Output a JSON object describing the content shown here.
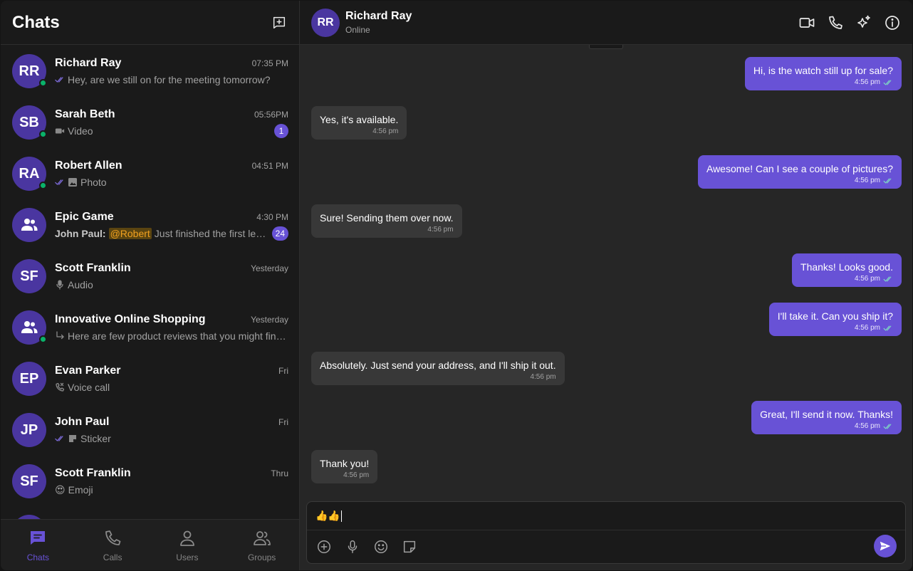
{
  "sidebar": {
    "title": "Chats",
    "chats": [
      {
        "initials": "RR",
        "name": "Richard Ray",
        "time": "07:35 PM",
        "preview": "Hey, are we still on for the meeting tomorrow?",
        "online": true,
        "read": true
      },
      {
        "initials": "SB",
        "name": "Sarah Beth",
        "time": "05:56PM",
        "preview": "Video",
        "online": true,
        "badge": "1"
      },
      {
        "initials": "RA",
        "name": "Robert Allen",
        "time": "04:51 PM",
        "preview": "Photo",
        "online": true,
        "read": true
      },
      {
        "name": "Epic Game",
        "time": "4:30 PM",
        "sender": "John Paul:",
        "mention": "@Robert",
        "preview": "Just finished the first level",
        "badge": "24",
        "group": true
      },
      {
        "initials": "SF",
        "name": "Scott Franklin",
        "time": "Yesterday",
        "preview": "Audio"
      },
      {
        "name": "Innovative Online Shopping",
        "time": "Yesterday",
        "preview": "Here are few product reviews that you might find useful",
        "online": true,
        "group": true
      },
      {
        "initials": "EP",
        "name": "Evan Parker",
        "time": "Fri",
        "preview": "Voice call"
      },
      {
        "initials": "JP",
        "name": "John Paul",
        "time": "Fri",
        "preview": "Sticker",
        "read": true
      },
      {
        "initials": "SF",
        "name": "Scott Franklin",
        "time": "Thru",
        "preview": "Emoji",
        "emoji": "😍"
      }
    ]
  },
  "nav": {
    "chats": "Chats",
    "calls": "Calls",
    "users": "Users",
    "groups": "Groups"
  },
  "conversation": {
    "initials": "RR",
    "name": "Richard Ray",
    "status": "Online",
    "messages": [
      {
        "dir": "out",
        "text": "Hi, is the watch still up for sale?",
        "time": "4:56 pm"
      },
      {
        "dir": "in",
        "text": "Yes, it's available.",
        "time": "4:56 pm"
      },
      {
        "dir": "out",
        "text": "Awesome! Can I see a couple of pictures?",
        "time": "4:56 pm"
      },
      {
        "dir": "in",
        "text": "Sure! Sending them over now.",
        "time": "4:56 pm"
      },
      {
        "dir": "out",
        "text": "Thanks! Looks good.",
        "time": "4:56 pm"
      },
      {
        "dir": "out",
        "text": "I'll take it. Can you ship it?",
        "time": "4:56 pm"
      },
      {
        "dir": "in",
        "text": "Absolutely. Just send your address, and I'll ship it out.",
        "time": "4:56 pm"
      },
      {
        "dir": "out",
        "text": "Great, I'll send it now. Thanks!",
        "time": "4:56 pm"
      },
      {
        "dir": "in",
        "text": "Thank you!",
        "time": "4:56 pm"
      }
    ]
  },
  "composer": {
    "value": "👍👍"
  },
  "colors": {
    "accent": "#6852d6",
    "avatar": "#4a36a0",
    "online": "#09b26a",
    "mention_bg": "#5a4410",
    "mention_fg": "#f0a020"
  }
}
